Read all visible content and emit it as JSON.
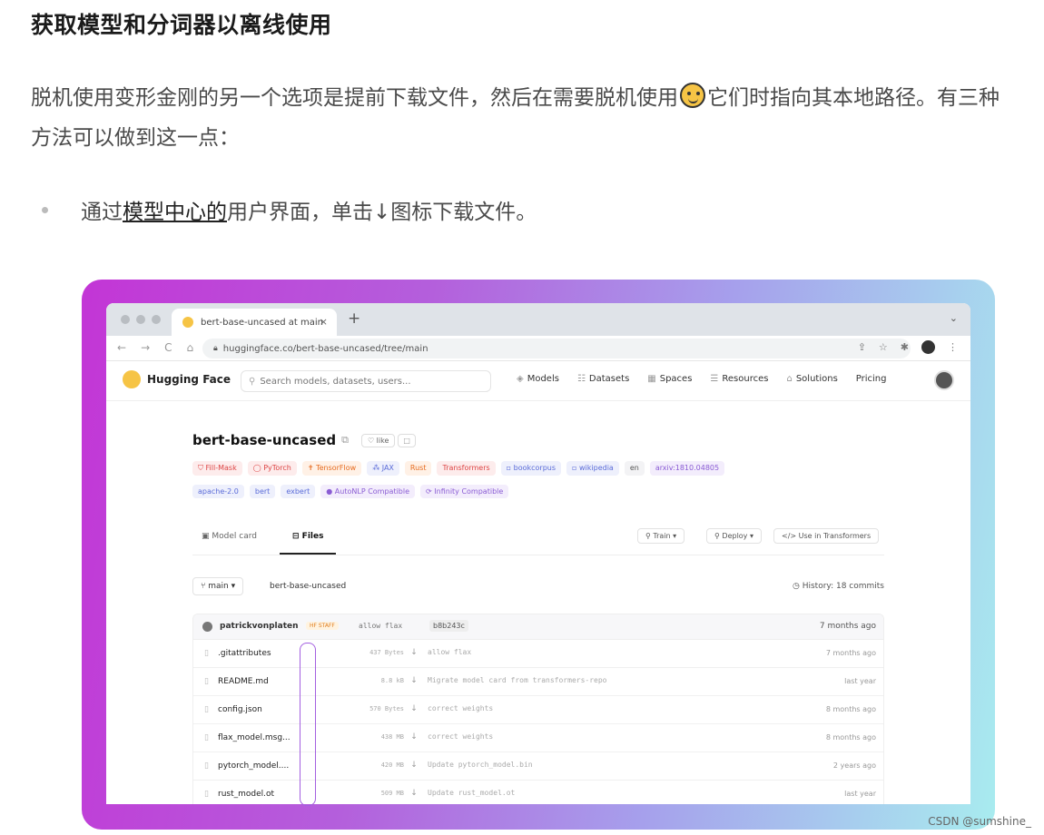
{
  "article": {
    "title": "获取模型和分词器以离线使用",
    "para_part1": "脱机使用变形金刚的另一个选项是提前下载文件，然后在需要脱机使用",
    "para_part2": "它们时指向其本地路径。有三种方法可以做到这一点：",
    "bullet_prefix": "通过",
    "bullet_link": "模型中心的",
    "bullet_suffix": "用户界面，单击↓图标下载文件。"
  },
  "browser": {
    "tab_title": "bert-base-uncased at main",
    "tab_close": "×",
    "new_tab": "+",
    "chevron": "⌄",
    "back": "←",
    "forward": "→",
    "reload": "C",
    "home": "⌂",
    "url": "huggingface.co/bert-base-uncased/tree/main",
    "share_icon": "⇪",
    "star_icon": "☆",
    "ext_icon": "✱",
    "more_icon": "⋮"
  },
  "hf": {
    "logo_text": "Hugging Face",
    "search_icon": "⚲",
    "search_placeholder": "Search models, datasets, users...",
    "menu": [
      {
        "icon": "◈",
        "label": "Models"
      },
      {
        "icon": "☷",
        "label": "Datasets"
      },
      {
        "icon": "▦",
        "label": "Spaces"
      },
      {
        "icon": "☰",
        "label": "Resources"
      },
      {
        "icon": "⌂",
        "label": "Solutions"
      },
      {
        "icon": "",
        "label": "Pricing"
      }
    ]
  },
  "repo": {
    "name": "bert-base-uncased",
    "copy_icon": "⧉",
    "like_label": "♡ like",
    "like_count": "□",
    "tags_row1": [
      {
        "label": "⛉  Fill-Mask",
        "color": "red"
      },
      {
        "label": "◯ PyTorch",
        "color": "red"
      },
      {
        "label": "✝ TensorFlow",
        "color": "orange"
      },
      {
        "label": "⁂ JAX",
        "color": "blue"
      },
      {
        "label": "Rust",
        "color": "orange"
      },
      {
        "label": "Transformers",
        "color": "red"
      },
      {
        "label": "▫ bookcorpus",
        "color": "blue"
      },
      {
        "label": "▫ wikipedia",
        "color": "blue"
      },
      {
        "label": "en",
        "color": "dark"
      },
      {
        "label": "arxiv:1810.04805",
        "color": "violet"
      }
    ],
    "tags_row2": [
      {
        "label": "apache-2.0",
        "color": "blue"
      },
      {
        "label": "bert",
        "color": "blue"
      },
      {
        "label": "exbert",
        "color": "blue"
      },
      {
        "label": "● AutoNLP Compatible",
        "color": "violet"
      },
      {
        "label": "⟳ Infinity Compatible",
        "color": "violet"
      }
    ],
    "tab_model_card": "▣ Model card",
    "tab_files": "⊟ Files",
    "btn_train": "⚲ Train ▾",
    "btn_deploy": "⚲ Deploy ▾",
    "btn_use": "</> Use in Transformers",
    "branch": "⑂ main ▾",
    "path": "bert-base-uncased",
    "history": "◷ History: 18 commits"
  },
  "commit": {
    "user": "patrickvonplaten",
    "badge": "HF STAFF",
    "message": "allow flax",
    "hash": "b8b243c",
    "time": "7 months ago"
  },
  "files": [
    {
      "name": ".gitattributes",
      "size": "437 Bytes",
      "message": "allow flax",
      "time": "7 months ago"
    },
    {
      "name": "README.md",
      "size": "8.8 kB",
      "message": "Migrate model card from transformers-repo",
      "time": "last year"
    },
    {
      "name": "config.json",
      "size": "570 Bytes",
      "message": "correct weights",
      "time": "8 months ago"
    },
    {
      "name": "flax_model.msg...",
      "size": "438 MB",
      "message": "correct weights",
      "time": "8 months ago"
    },
    {
      "name": "pytorch_model....",
      "size": "420 MB",
      "message": "Update pytorch_model.bin",
      "time": "2 years ago"
    },
    {
      "name": "rust_model.ot",
      "size": "509 MB",
      "message": "Update rust_model.ot",
      "time": "last year"
    }
  ],
  "file_icon": "▯",
  "download_icon": "↓",
  "watermark": "CSDN @sumshine_"
}
